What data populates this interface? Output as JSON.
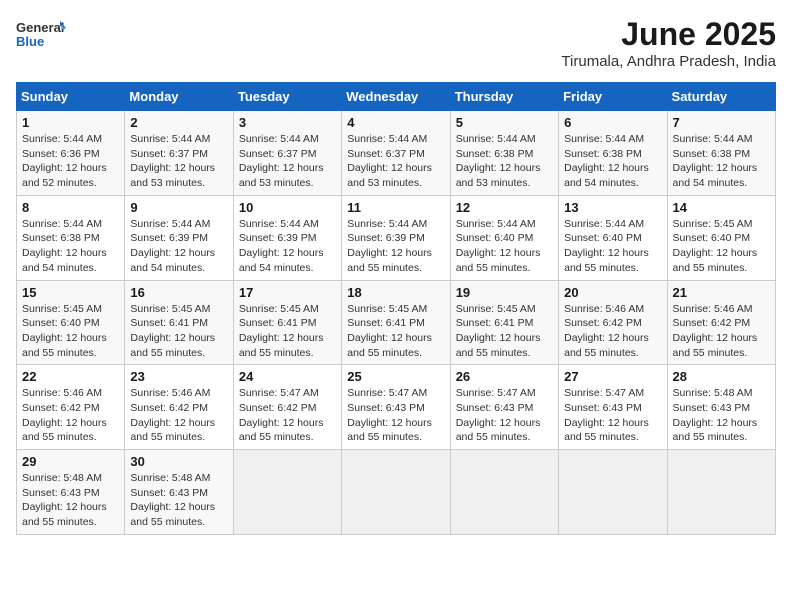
{
  "logo": {
    "line1": "General",
    "line2": "Blue"
  },
  "title": "June 2025",
  "subtitle": "Tirumala, Andhra Pradesh, India",
  "days_header": [
    "Sunday",
    "Monday",
    "Tuesday",
    "Wednesday",
    "Thursday",
    "Friday",
    "Saturday"
  ],
  "weeks": [
    [
      {
        "day": "1",
        "info": "Sunrise: 5:44 AM\nSunset: 6:36 PM\nDaylight: 12 hours\nand 52 minutes."
      },
      {
        "day": "2",
        "info": "Sunrise: 5:44 AM\nSunset: 6:37 PM\nDaylight: 12 hours\nand 53 minutes."
      },
      {
        "day": "3",
        "info": "Sunrise: 5:44 AM\nSunset: 6:37 PM\nDaylight: 12 hours\nand 53 minutes."
      },
      {
        "day": "4",
        "info": "Sunrise: 5:44 AM\nSunset: 6:37 PM\nDaylight: 12 hours\nand 53 minutes."
      },
      {
        "day": "5",
        "info": "Sunrise: 5:44 AM\nSunset: 6:38 PM\nDaylight: 12 hours\nand 53 minutes."
      },
      {
        "day": "6",
        "info": "Sunrise: 5:44 AM\nSunset: 6:38 PM\nDaylight: 12 hours\nand 54 minutes."
      },
      {
        "day": "7",
        "info": "Sunrise: 5:44 AM\nSunset: 6:38 PM\nDaylight: 12 hours\nand 54 minutes."
      }
    ],
    [
      {
        "day": "8",
        "info": "Sunrise: 5:44 AM\nSunset: 6:38 PM\nDaylight: 12 hours\nand 54 minutes."
      },
      {
        "day": "9",
        "info": "Sunrise: 5:44 AM\nSunset: 6:39 PM\nDaylight: 12 hours\nand 54 minutes."
      },
      {
        "day": "10",
        "info": "Sunrise: 5:44 AM\nSunset: 6:39 PM\nDaylight: 12 hours\nand 54 minutes."
      },
      {
        "day": "11",
        "info": "Sunrise: 5:44 AM\nSunset: 6:39 PM\nDaylight: 12 hours\nand 55 minutes."
      },
      {
        "day": "12",
        "info": "Sunrise: 5:44 AM\nSunset: 6:40 PM\nDaylight: 12 hours\nand 55 minutes."
      },
      {
        "day": "13",
        "info": "Sunrise: 5:44 AM\nSunset: 6:40 PM\nDaylight: 12 hours\nand 55 minutes."
      },
      {
        "day": "14",
        "info": "Sunrise: 5:45 AM\nSunset: 6:40 PM\nDaylight: 12 hours\nand 55 minutes."
      }
    ],
    [
      {
        "day": "15",
        "info": "Sunrise: 5:45 AM\nSunset: 6:40 PM\nDaylight: 12 hours\nand 55 minutes."
      },
      {
        "day": "16",
        "info": "Sunrise: 5:45 AM\nSunset: 6:41 PM\nDaylight: 12 hours\nand 55 minutes."
      },
      {
        "day": "17",
        "info": "Sunrise: 5:45 AM\nSunset: 6:41 PM\nDaylight: 12 hours\nand 55 minutes."
      },
      {
        "day": "18",
        "info": "Sunrise: 5:45 AM\nSunset: 6:41 PM\nDaylight: 12 hours\nand 55 minutes."
      },
      {
        "day": "19",
        "info": "Sunrise: 5:45 AM\nSunset: 6:41 PM\nDaylight: 12 hours\nand 55 minutes."
      },
      {
        "day": "20",
        "info": "Sunrise: 5:46 AM\nSunset: 6:42 PM\nDaylight: 12 hours\nand 55 minutes."
      },
      {
        "day": "21",
        "info": "Sunrise: 5:46 AM\nSunset: 6:42 PM\nDaylight: 12 hours\nand 55 minutes."
      }
    ],
    [
      {
        "day": "22",
        "info": "Sunrise: 5:46 AM\nSunset: 6:42 PM\nDaylight: 12 hours\nand 55 minutes."
      },
      {
        "day": "23",
        "info": "Sunrise: 5:46 AM\nSunset: 6:42 PM\nDaylight: 12 hours\nand 55 minutes."
      },
      {
        "day": "24",
        "info": "Sunrise: 5:47 AM\nSunset: 6:42 PM\nDaylight: 12 hours\nand 55 minutes."
      },
      {
        "day": "25",
        "info": "Sunrise: 5:47 AM\nSunset: 6:43 PM\nDaylight: 12 hours\nand 55 minutes."
      },
      {
        "day": "26",
        "info": "Sunrise: 5:47 AM\nSunset: 6:43 PM\nDaylight: 12 hours\nand 55 minutes."
      },
      {
        "day": "27",
        "info": "Sunrise: 5:47 AM\nSunset: 6:43 PM\nDaylight: 12 hours\nand 55 minutes."
      },
      {
        "day": "28",
        "info": "Sunrise: 5:48 AM\nSunset: 6:43 PM\nDaylight: 12 hours\nand 55 minutes."
      }
    ],
    [
      {
        "day": "29",
        "info": "Sunrise: 5:48 AM\nSunset: 6:43 PM\nDaylight: 12 hours\nand 55 minutes."
      },
      {
        "day": "30",
        "info": "Sunrise: 5:48 AM\nSunset: 6:43 PM\nDaylight: 12 hours\nand 55 minutes."
      },
      {
        "day": "",
        "info": ""
      },
      {
        "day": "",
        "info": ""
      },
      {
        "day": "",
        "info": ""
      },
      {
        "day": "",
        "info": ""
      },
      {
        "day": "",
        "info": ""
      }
    ]
  ]
}
